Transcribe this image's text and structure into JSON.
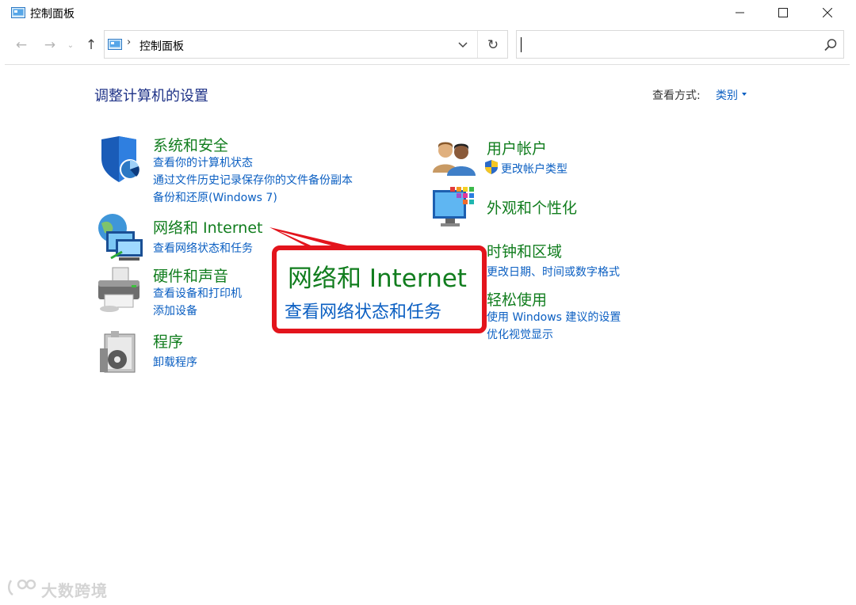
{
  "window": {
    "title": "控制面板",
    "minimize_glyph": "—",
    "maximize_glyph": "☐",
    "close_glyph": "✕"
  },
  "nav": {
    "back_glyph": "←",
    "forward_glyph": "→",
    "recent_glyph": "⌄",
    "up_glyph": "↑",
    "address_separator": "›",
    "address_text": "控制面板",
    "refresh_glyph": "↻",
    "search_value": "",
    "search_placeholder": ""
  },
  "header": {
    "title": "调整计算机的设置",
    "viewby_label": "查看方式:",
    "viewby_value": "类别"
  },
  "categories": {
    "system": {
      "title": "系统和安全",
      "icon": "shield-icon",
      "links": [
        "查看你的计算机状态",
        "通过文件历史记录保存你的文件备份副本",
        "备份和还原(Windows 7)"
      ]
    },
    "network": {
      "title": "网络和 Internet",
      "icon": "network-icon",
      "links": [
        "查看网络状态和任务"
      ]
    },
    "hardware": {
      "title": "硬件和声音",
      "icon": "printer-icon",
      "links": [
        "查看设备和打印机",
        "添加设备"
      ]
    },
    "programs": {
      "title": "程序",
      "icon": "programs-icon",
      "links": [
        "卸载程序"
      ]
    },
    "users": {
      "title": "用户帐户",
      "icon": "users-icon",
      "links": [
        "更改帐户类型"
      ]
    },
    "appearance": {
      "title": "外观和个性化",
      "icon": "appearance-icon",
      "links": []
    },
    "clock": {
      "title": "时钟和区域",
      "icon": "clock-icon",
      "links": [
        "更改日期、时间或数字格式"
      ]
    },
    "ease": {
      "title": "轻松使用",
      "icon": "ease-of-access-icon",
      "links": [
        "使用 Windows 建议的设置",
        "优化视觉显示"
      ]
    }
  },
  "callout": {
    "title": "网络和 Internet",
    "link": "查看网络状态和任务"
  },
  "watermark": "大数跨境",
  "colors": {
    "category_title": "#117d1e",
    "link": "#0b5fc2",
    "heading": "#1e3287",
    "callout_border": "#e3141c"
  }
}
